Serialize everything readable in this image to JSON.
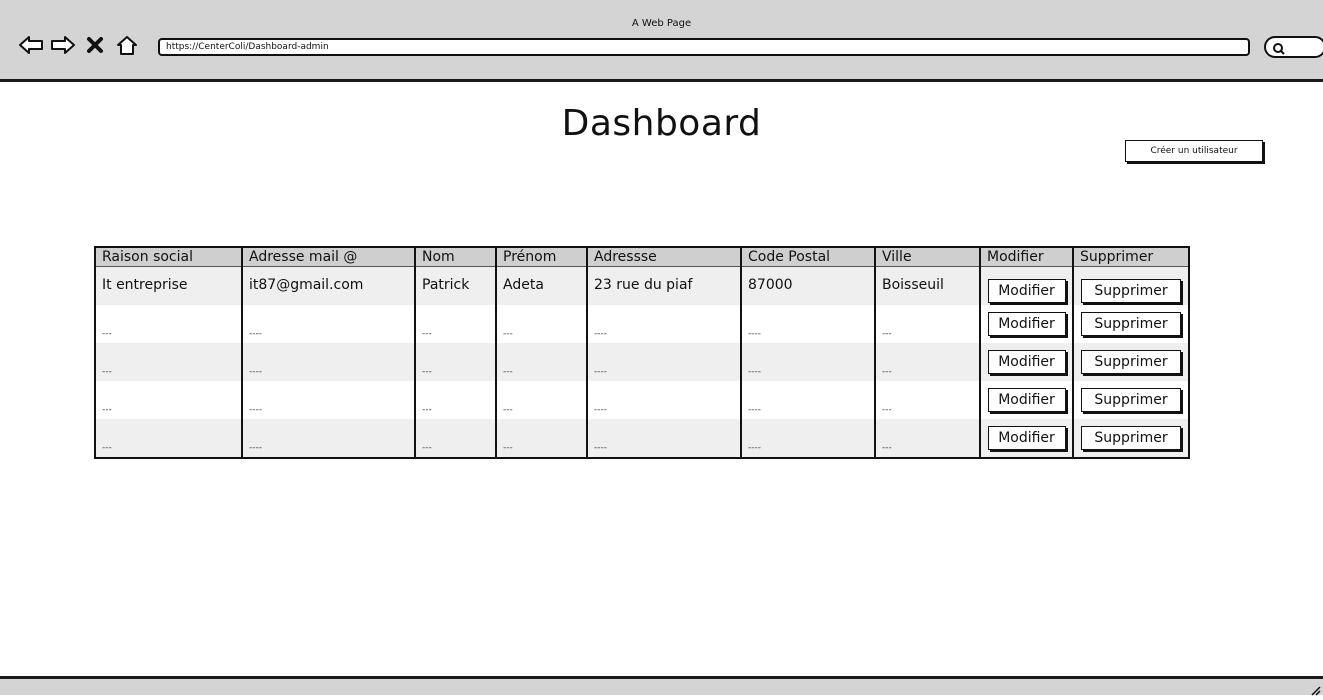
{
  "browser": {
    "window_title": "A Web Page",
    "url": "https://CenterColi/Dashboard-admin",
    "icons": [
      "back-arrow-icon",
      "forward-arrow-icon",
      "close-icon",
      "home-icon",
      "search-icon"
    ]
  },
  "page": {
    "title": "Dashboard",
    "create_user_label": "Créer un utilisateur"
  },
  "table": {
    "columns": [
      "Raison social",
      "Adresse mail @",
      "Nom",
      "Prénom",
      "Adressse",
      "Code Postal",
      "Ville",
      "Modifier",
      "Supprimer"
    ],
    "rows": [
      {
        "raison_social": "It entreprise",
        "email": "it87@gmail.com",
        "nom": "Patrick",
        "prenom": "Adeta",
        "adresse": "23 rue du piaf",
        "code_postal": "87000",
        "ville": "Boisseuil",
        "modifier": "Modifier",
        "supprimer": "Supprimer"
      },
      {
        "raison_social": "---",
        "email": "----",
        "nom": "---",
        "prenom": "---",
        "adresse": "----",
        "code_postal": "----",
        "ville": "---",
        "modifier": "Modifier",
        "supprimer": "Supprimer"
      },
      {
        "raison_social": "---",
        "email": "----",
        "nom": "---",
        "prenom": "---",
        "adresse": "----",
        "code_postal": "----",
        "ville": "---",
        "modifier": "Modifier",
        "supprimer": "Supprimer"
      },
      {
        "raison_social": "---",
        "email": "----",
        "nom": "---",
        "prenom": "---",
        "adresse": "----",
        "code_postal": "----",
        "ville": "---",
        "modifier": "Modifier",
        "supprimer": "Supprimer"
      },
      {
        "raison_social": "---",
        "email": "----",
        "nom": "---",
        "prenom": "---",
        "adresse": "----",
        "code_postal": "----",
        "ville": "---",
        "modifier": "Modifier",
        "supprimer": "Supprimer"
      }
    ]
  }
}
